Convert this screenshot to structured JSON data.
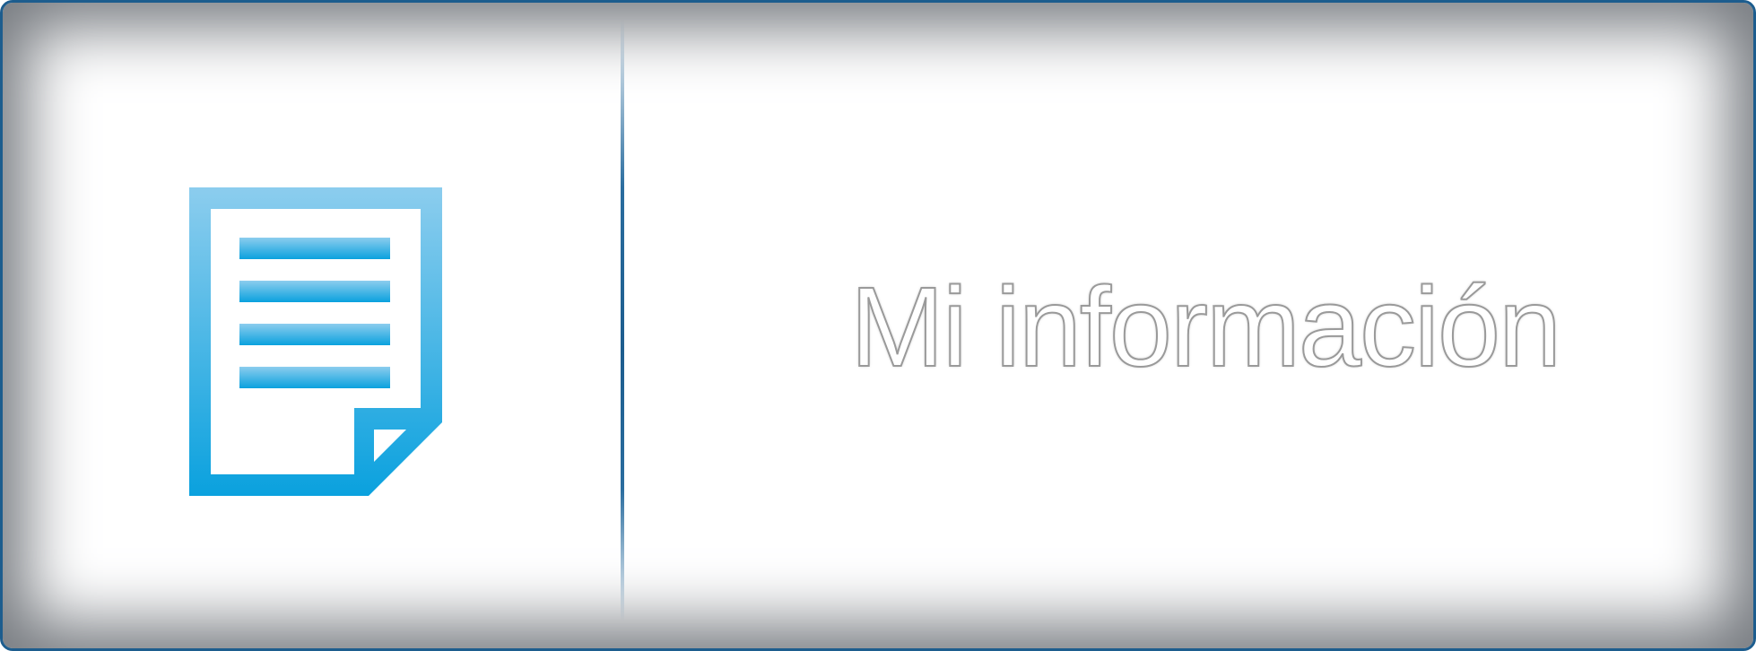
{
  "tile": {
    "label": "Mi información",
    "icon": "document-icon",
    "border_color": "#1d5d8e",
    "icon_color_top": "#8ccdee",
    "icon_color_bottom": "#0aa1de"
  }
}
